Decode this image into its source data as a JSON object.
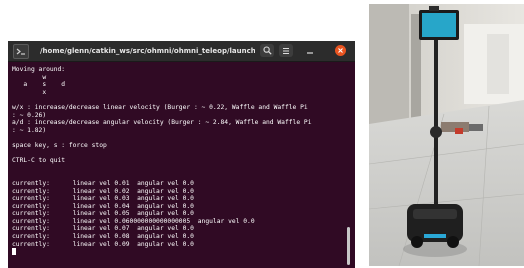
{
  "terminal": {
    "title": "/home/glenn/catkin_ws/src/ohmni/ohmni_teleop/launch/oh...",
    "lines": [
      "Moving around:",
      "        w",
      "   a    s    d",
      "        x",
      "",
      "w/x : increase/decrease linear velocity (Burger : ~ 0.22, Waffle and Waffle Pi",
      ": ~ 0.26)",
      "a/d : increase/decrease angular velocity (Burger : ~ 2.84, Waffle and Waffle Pi",
      ": ~ 1.82)",
      "",
      "space key, s : force stop",
      "",
      "CTRL-C to quit",
      "",
      "",
      "currently:      linear vel 0.01  angular vel 0.0",
      "currently:      linear vel 0.02  angular vel 0.0",
      "currently:      linear vel 0.03  angular vel 0.0",
      "currently:      linear vel 0.04  angular vel 0.0",
      "currently:      linear vel 0.05  angular vel 0.0",
      "currently:      linear vel 0.060000000000000005  angular vel 0.0",
      "currently:      linear vel 0.07  angular vel 0.0",
      "currently:      linear vel 0.08  angular vel 0.0",
      "currently:      linear vel 0.09  angular vel 0.0"
    ]
  },
  "icons": {
    "terminal": "terminal-icon",
    "search": "search-icon",
    "menu": "hamburger-menu-icon",
    "minimize": "minimize-icon",
    "close": "close-icon"
  },
  "colors": {
    "terminal_bg": "#300a24",
    "titlebar_bg": "#2c2c2c",
    "close_button": "#e95420",
    "text": "#ffffff"
  }
}
